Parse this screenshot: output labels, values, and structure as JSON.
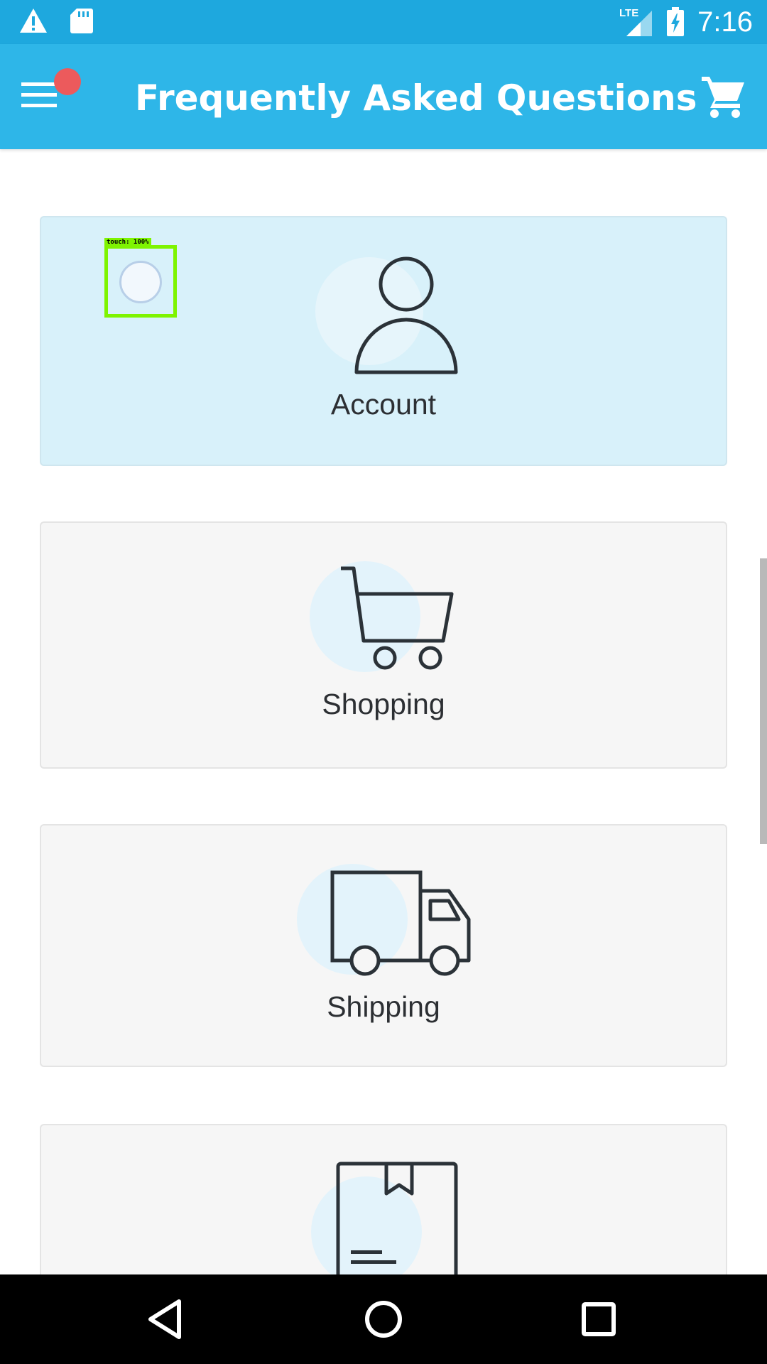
{
  "status_bar": {
    "time": "7:16",
    "network": "LTE",
    "icons": [
      "warning-icon",
      "sd-card-icon",
      "signal-icon",
      "battery-charging-icon"
    ],
    "background": "#1ea8de"
  },
  "app_bar": {
    "title": "Frequently Asked Questions",
    "menu_icon": "hamburger-menu-icon",
    "cart_icon": "shopping-cart-icon",
    "background": "#2eb6e8",
    "notification_dot_color": "#ec5a5c"
  },
  "categories": [
    {
      "label": "Account",
      "icon": "person-icon",
      "selected": true
    },
    {
      "label": "Shopping",
      "icon": "cart-icon",
      "selected": false
    },
    {
      "label": "Shipping",
      "icon": "truck-icon",
      "selected": false
    },
    {
      "label": "",
      "icon": "document-icon",
      "selected": false
    }
  ],
  "touch_overlay": {
    "label": "touch: 100%"
  },
  "nav_bar": {
    "buttons": [
      "back-icon",
      "home-icon",
      "recents-icon"
    ]
  },
  "colors": {
    "selected_card": "#d8f1fa",
    "card": "#f6f6f6",
    "icon_stroke": "#2b3238",
    "touch_indicator": "#7ef400"
  }
}
